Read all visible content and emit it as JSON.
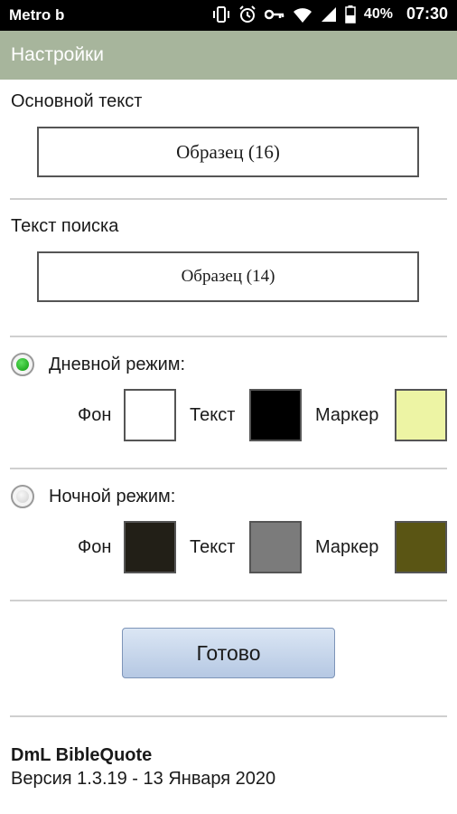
{
  "status": {
    "carrier": "Metro b",
    "battery": "40%",
    "time": "07:30",
    "icons": [
      "vibrate-icon",
      "alarm-icon",
      "key-icon",
      "wifi-icon",
      "signal-icon",
      "battery-icon"
    ]
  },
  "app": {
    "title": "Настройки"
  },
  "main_text": {
    "label": "Основной текст",
    "sample": "Образец (16)"
  },
  "search_text": {
    "label": "Текст поиска",
    "sample": "Образец (14)"
  },
  "day_mode": {
    "label": "Дневной режим:",
    "selected": true,
    "background_label": "Фон",
    "text_label": "Текст",
    "marker_label": "Маркер",
    "colors": {
      "background": "#ffffff",
      "text": "#000000",
      "marker": "#edf4a4"
    }
  },
  "night_mode": {
    "label": "Ночной режим:",
    "selected": false,
    "background_label": "Фон",
    "text_label": "Текст",
    "marker_label": "Маркер",
    "colors": {
      "background": "#221f17",
      "text": "#7b7b7b",
      "marker": "#5a5514"
    }
  },
  "done_button": {
    "label": "Готово"
  },
  "footer": {
    "app_name": "DmL BibleQuote",
    "version": "Версия 1.3.19 - 13 Января 2020"
  },
  "theme": {
    "titlebar": "#a7b59c",
    "button": "#c6d6ec"
  }
}
